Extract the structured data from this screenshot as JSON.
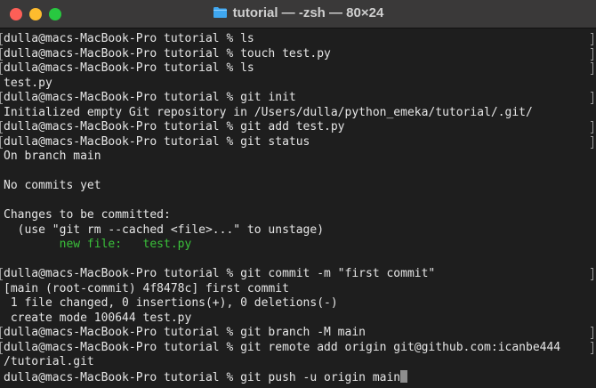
{
  "window": {
    "title": "tutorial — -zsh — 80×24",
    "folder_icon": "folder-icon",
    "traffic_lights": {
      "close": "#fd5f57",
      "minimize": "#febc2e",
      "maximize": "#28c840"
    }
  },
  "terminal": {
    "lines": [
      {
        "text": "dulla@macs-MacBook-Pro tutorial % ls",
        "type": "prompt"
      },
      {
        "text": "dulla@macs-MacBook-Pro tutorial % touch test.py",
        "type": "prompt"
      },
      {
        "text": "dulla@macs-MacBook-Pro tutorial % ls",
        "type": "prompt"
      },
      {
        "text": "test.py",
        "type": "output"
      },
      {
        "text": "dulla@macs-MacBook-Pro tutorial % git init",
        "type": "prompt"
      },
      {
        "text": "Initialized empty Git repository in /Users/dulla/python_emeka/tutorial/.git/",
        "type": "output"
      },
      {
        "text": "dulla@macs-MacBook-Pro tutorial % git add test.py",
        "type": "prompt"
      },
      {
        "text": "dulla@macs-MacBook-Pro tutorial % git status",
        "type": "prompt"
      },
      {
        "text": "On branch main",
        "type": "output"
      },
      {
        "text": "",
        "type": "blank"
      },
      {
        "text": "No commits yet",
        "type": "output"
      },
      {
        "text": "",
        "type": "blank"
      },
      {
        "text": "Changes to be committed:",
        "type": "output"
      },
      {
        "text": "  (use \"git rm --cached <file>...\" to unstage)",
        "type": "output"
      },
      {
        "text": "        new file:   test.py",
        "type": "staged"
      },
      {
        "text": "",
        "type": "blank"
      },
      {
        "text": "dulla@macs-MacBook-Pro tutorial % git commit -m \"first commit\"",
        "type": "prompt"
      },
      {
        "text": "[main (root-commit) 4f8478c] first commit",
        "type": "output"
      },
      {
        "text": " 1 file changed, 0 insertions(+), 0 deletions(-)",
        "type": "output"
      },
      {
        "text": " create mode 100644 test.py",
        "type": "output"
      },
      {
        "text": "dulla@macs-MacBook-Pro tutorial % git branch -M main",
        "type": "prompt"
      },
      {
        "text": "dulla@macs-MacBook-Pro tutorial % git remote add origin git@github.com:icanbe444",
        "type": "prompt"
      },
      {
        "text": "/tutorial.git",
        "type": "output"
      },
      {
        "text": "dulla@macs-MacBook-Pro tutorial % git push -u origin main",
        "type": "current"
      }
    ],
    "colors": {
      "background": "#1e1e1e",
      "text": "#e6e6e6",
      "staged": "#3ac13a"
    }
  }
}
